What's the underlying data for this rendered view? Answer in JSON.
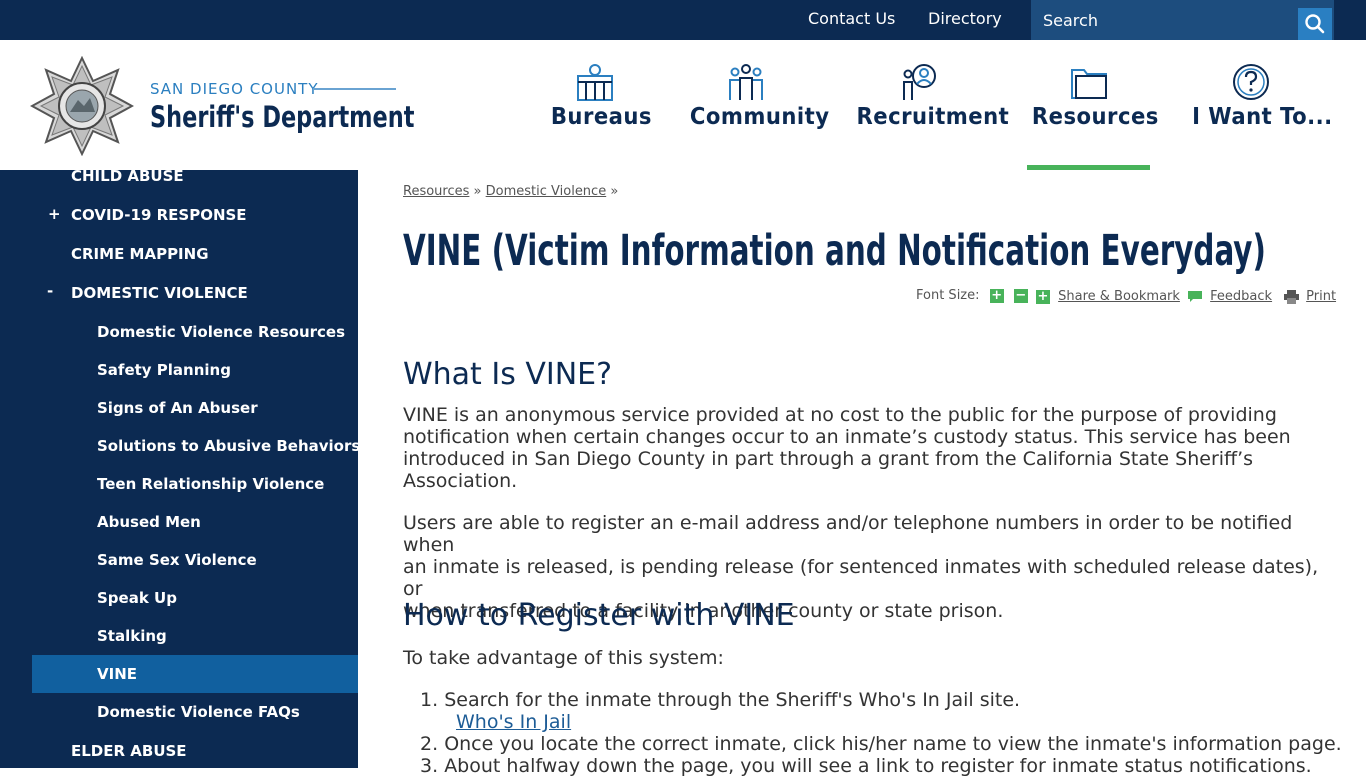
{
  "topbar": {
    "contact_label": "Contact Us",
    "directory_label": "Directory",
    "search_placeholder": "Search"
  },
  "header": {
    "logo_county": "SAN DIEGO COUNTY",
    "logo_department": "Sheriff's Department",
    "nav": [
      {
        "label": "Bureaus",
        "icon": "building-badge-icon"
      },
      {
        "label": "Community",
        "icon": "people-group-icon"
      },
      {
        "label": "Recruitment",
        "icon": "recruit-search-icon"
      },
      {
        "label": "Resources",
        "icon": "folder-icon"
      },
      {
        "label": "I Want To...",
        "icon": "question-circle-icon"
      }
    ],
    "active_nav": "Resources"
  },
  "sidebar": {
    "items": [
      {
        "label": "CHILD ABUSE",
        "level": 1,
        "toggle": ""
      },
      {
        "label": "COVID-19 RESPONSE",
        "level": 1,
        "toggle": "+"
      },
      {
        "label": "CRIME MAPPING",
        "level": 1,
        "toggle": ""
      },
      {
        "label": "DOMESTIC VIOLENCE",
        "level": 1,
        "toggle": "-"
      },
      {
        "label": "Domestic Violence Resources",
        "level": 2
      },
      {
        "label": "Safety Planning",
        "level": 2
      },
      {
        "label": "Signs of An Abuser",
        "level": 2
      },
      {
        "label": "Solutions to Abusive Behaviors",
        "level": 2
      },
      {
        "label": "Teen Relationship Violence",
        "level": 2
      },
      {
        "label": "Abused Men",
        "level": 2
      },
      {
        "label": "Same Sex Violence",
        "level": 2
      },
      {
        "label": "Speak Up",
        "level": 2
      },
      {
        "label": "Stalking",
        "level": 2
      },
      {
        "label": "VINE",
        "level": 2,
        "active": true
      },
      {
        "label": "Domestic Violence FAQs",
        "level": 2
      },
      {
        "label": "ELDER ABUSE",
        "level": 1,
        "toggle": ""
      }
    ]
  },
  "breadcrumb": {
    "items": [
      "Resources",
      "Domestic Violence"
    ],
    "separator": "»"
  },
  "page": {
    "title": "VINE (Victim Information and Notification Everyday)",
    "tools": {
      "font_size_label": "Font Size:",
      "font_plus": "+",
      "font_minus": "−",
      "share_label": "Share & Bookmark",
      "feedback_label": "Feedback",
      "print_label": "Print"
    },
    "section1_heading": "What Is VINE?",
    "para1_lines": [
      "VINE is an anonymous service provided at no cost to the public for the purpose of providing",
      "notification when certain changes occur to an inmate’s custody status. This service has been",
      "introduced in San Diego County in part through a grant from the California State Sheriff’s",
      "Association."
    ],
    "para2_lines": [
      "Users are able to register an e-mail address and/or telephone numbers in order to be notified when",
      "an inmate is released, is pending release (for sentenced inmates with scheduled release dates), or",
      "when transferred to a facility in another county or state prison."
    ],
    "section2_heading": "How to Register with VINE",
    "intro": "To take advantage of this system:",
    "steps": [
      {
        "num": "1.",
        "text": "Search for the inmate through the Sheriff's Who's In Jail site.",
        "link": "Who's In Jail"
      },
      {
        "num": "2.",
        "text": "Once you locate the correct inmate, click his/her name to view the inmate's information page."
      },
      {
        "num": "3.",
        "text": "About halfway down the page, you will see a link to register for inmate status notifications."
      }
    ]
  },
  "colors": {
    "navy": "#0c2a52",
    "accent_blue": "#2b7fc0",
    "active_item": "#11609f",
    "green": "#48b35a"
  }
}
